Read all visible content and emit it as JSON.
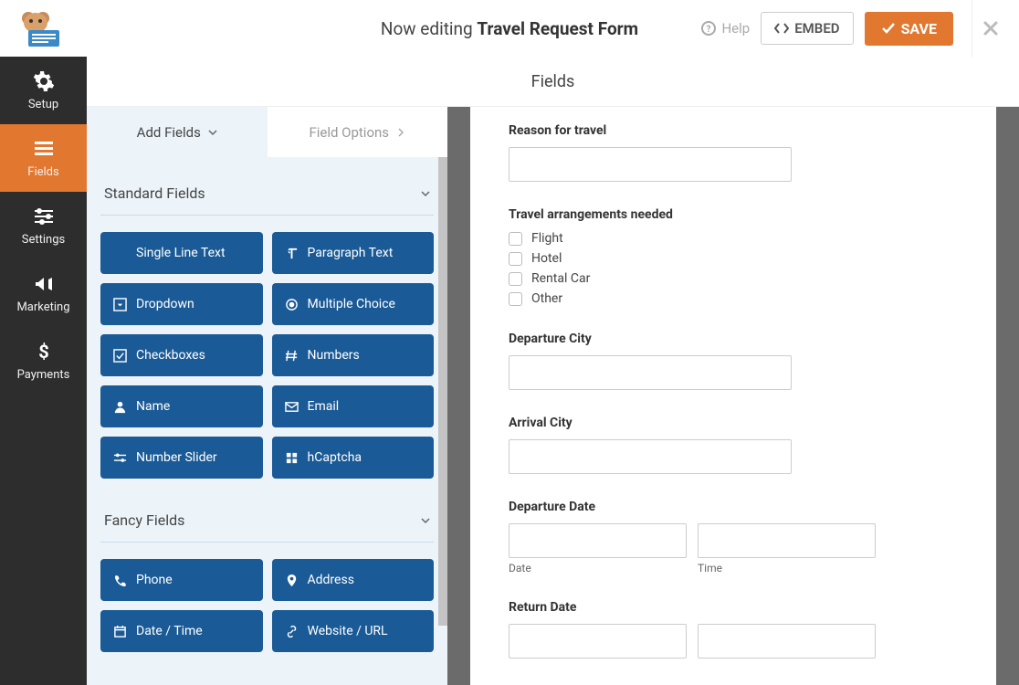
{
  "topbar": {
    "editing_prefix": "Now editing",
    "form_name": "Travel Request Form",
    "help_label": "Help",
    "embed_label": "EMBED",
    "save_label": "SAVE"
  },
  "vnav": {
    "items": [
      {
        "label": "Setup"
      },
      {
        "label": "Fields"
      },
      {
        "label": "Settings"
      },
      {
        "label": "Marketing"
      },
      {
        "label": "Payments"
      }
    ]
  },
  "section_title": "Fields",
  "panel": {
    "tabs": {
      "add": "Add Fields",
      "options": "Field Options"
    },
    "groups": {
      "standard": {
        "title": "Standard Fields",
        "items": [
          "Single Line Text",
          "Paragraph Text",
          "Dropdown",
          "Multiple Choice",
          "Checkboxes",
          "Numbers",
          "Name",
          "Email",
          "Number Slider",
          "hCaptcha"
        ]
      },
      "fancy": {
        "title": "Fancy Fields",
        "items": [
          "Phone",
          "Address",
          "Date / Time",
          "Website / URL"
        ]
      }
    }
  },
  "preview": {
    "reason_label": "Reason for travel",
    "arrangements_label": "Travel arrangements needed",
    "arrangements_options": [
      "Flight",
      "Hotel",
      "Rental Car",
      "Other"
    ],
    "departure_city_label": "Departure City",
    "arrival_city_label": "Arrival City",
    "departure_date_label": "Departure Date",
    "return_date_label": "Return Date",
    "date_sublabel": "Date",
    "time_sublabel": "Time"
  }
}
